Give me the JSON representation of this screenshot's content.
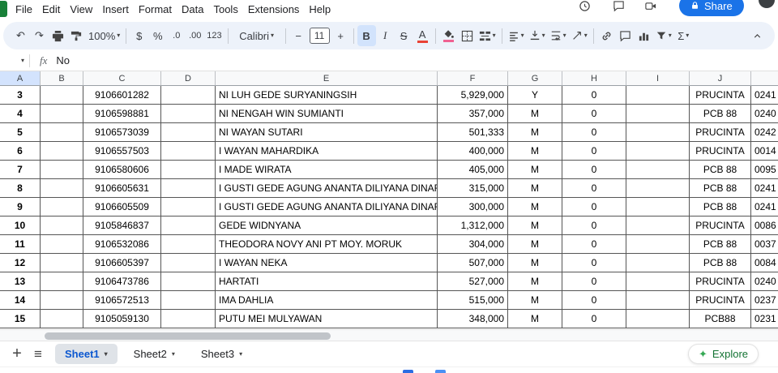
{
  "menu": {
    "items": [
      "File",
      "Edit",
      "View",
      "Insert",
      "Format",
      "Data",
      "Tools",
      "Extensions",
      "Help"
    ]
  },
  "topbar": {
    "share_label": "Share"
  },
  "toolbar": {
    "zoom": "100%",
    "currency": "$",
    "percent": "%",
    "decrease_decimal": ".0",
    "increase_decimal": ".00",
    "more_formats": "123",
    "font": "Calibri",
    "decrease_size": "−",
    "font_size": "11",
    "increase_size": "+",
    "bold": "B",
    "italic": "I",
    "strikethrough": "S",
    "text_color": "A",
    "functions": "Σ"
  },
  "icons": {
    "undo": "↶",
    "redo": "↷",
    "caret": "▾",
    "hamburger": "≡",
    "plus": "+",
    "explore_star": "✦"
  },
  "formula_bar": {
    "fx": "fx",
    "value": "No"
  },
  "grid": {
    "selected_column_index": 0,
    "column_headers": [
      "A",
      "B",
      "C",
      "D",
      "E",
      "F",
      "G",
      "H",
      "I",
      "J",
      ""
    ],
    "rows": [
      [
        "3",
        "",
        "9106601282",
        "",
        "NI LUH GEDE SURYANINGSIH",
        "5,929,000",
        "Y",
        "0",
        "",
        "PRUCINTA",
        "0241"
      ],
      [
        "4",
        "",
        "9106598881",
        "",
        "NI NENGAH WIN SUMIANTI",
        "357,000",
        "M",
        "0",
        "",
        "PCB 88",
        "0240"
      ],
      [
        "5",
        "",
        "9106573039",
        "",
        "NI WAYAN SUTARI",
        "501,333",
        "M",
        "0",
        "",
        "PRUCINTA",
        "0242"
      ],
      [
        "6",
        "",
        "9106557503",
        "",
        "I WAYAN MAHARDIKA",
        "400,000",
        "M",
        "0",
        "",
        "PRUCINTA",
        "0014"
      ],
      [
        "7",
        "",
        "9106580606",
        "",
        "I MADE WIRATA",
        "405,000",
        "M",
        "0",
        "",
        "PCB 88",
        "0095"
      ],
      [
        "8",
        "",
        "9106605631",
        "",
        "I GUSTI GEDE AGUNG ANANTA DILIYANA DINAR",
        "315,000",
        "M",
        "0",
        "",
        "PCB 88",
        "0241"
      ],
      [
        "9",
        "",
        "9106605509",
        "",
        "I GUSTI GEDE AGUNG ANANTA DILIYANA DINAR",
        "300,000",
        "M",
        "0",
        "",
        "PCB 88",
        "0241"
      ],
      [
        "10",
        "",
        "9105846837",
        "",
        "GEDE WIDNYANA",
        "1,312,000",
        "M",
        "0",
        "",
        "PRUCINTA",
        "0086"
      ],
      [
        "11",
        "",
        "9106532086",
        "",
        "THEODORA NOVY ANI PT MOY. MORUK",
        "304,000",
        "M",
        "0",
        "",
        "PCB 88",
        "0037"
      ],
      [
        "12",
        "",
        "9106605397",
        "",
        "I WAYAN NEKA",
        "507,000",
        "M",
        "0",
        "",
        "PCB 88",
        "0084"
      ],
      [
        "13",
        "",
        "9106473786",
        "",
        "HARTATI",
        "527,000",
        "M",
        "0",
        "",
        "PRUCINTA",
        "0240"
      ],
      [
        "14",
        "",
        "9106572513",
        "",
        "IMA DAHLIA",
        "515,000",
        "M",
        "0",
        "",
        "PRUCINTA",
        "0237"
      ],
      [
        "15",
        "",
        "9105059130",
        "",
        "PUTU MEI MULYAWAN",
        "348,000",
        "M",
        "0",
        "",
        "PCB88",
        "0231"
      ]
    ]
  },
  "sheet_bar": {
    "tabs": [
      {
        "label": "Sheet1",
        "active": true
      },
      {
        "label": "Sheet2",
        "active": false
      },
      {
        "label": "Sheet3",
        "active": false
      }
    ],
    "explore_label": "Explore"
  },
  "colors": {
    "accent": "#1a73e8",
    "toolbar_bg": "#edf2fa",
    "selected_header_bg": "#d3e3fd",
    "logo_green": "#188038"
  }
}
